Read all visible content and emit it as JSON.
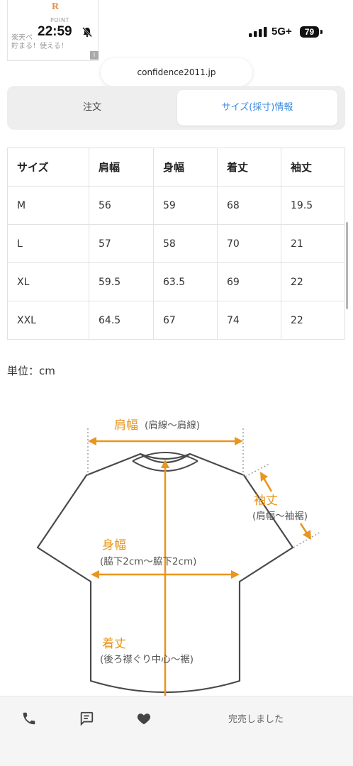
{
  "ad": {
    "logo": "R",
    "point_label": "POINT",
    "line1": "楽天ペ",
    "line2": "貯まる！使える！",
    "info_icon": "info-icon"
  },
  "status_bar": {
    "time": "22:59",
    "network": "5G+",
    "battery": "79"
  },
  "browser": {
    "url": "confidence2011.jp"
  },
  "tabs": [
    {
      "label": "注文",
      "active": false
    },
    {
      "label": "サイズ(採寸)情報",
      "active": true
    }
  ],
  "size_table": {
    "headers": [
      "サイズ",
      "肩幅",
      "身幅",
      "着丈",
      "袖丈"
    ],
    "rows": [
      [
        "M",
        "56",
        "59",
        "68",
        "19.5"
      ],
      [
        "L",
        "57",
        "58",
        "70",
        "21"
      ],
      [
        "XL",
        "59.5",
        "63.5",
        "69",
        "22"
      ],
      [
        "XXL",
        "64.5",
        "67",
        "74",
        "22"
      ]
    ]
  },
  "unit_text": "単位：cm",
  "diagram": {
    "shoulder": {
      "label": "肩幅",
      "note": "(肩線～肩線)"
    },
    "sleeve": {
      "label": "袖丈",
      "note": "(肩幅～袖裾)"
    },
    "chest": {
      "label": "身幅",
      "note": "(脇下2cm～脇下2cm)"
    },
    "length": {
      "label": "着丈",
      "note": "(後ろ襟ぐり中心～裾)"
    },
    "accent_color": "#e8961e",
    "outline_color": "#4a4a4a"
  },
  "bottom_bar": {
    "icons": [
      "phone-icon",
      "chat-icon",
      "heart-icon"
    ],
    "soldout_label": "完売しました"
  }
}
